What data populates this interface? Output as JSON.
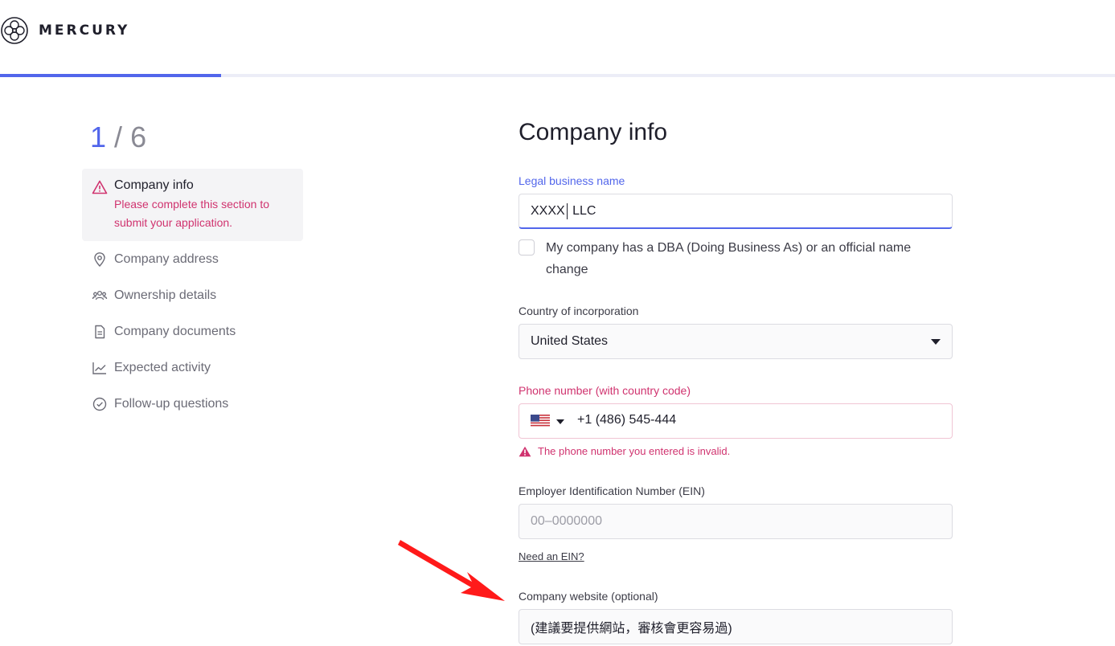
{
  "brand": {
    "name": "MERCURY"
  },
  "progress": {
    "fraction": 0.198
  },
  "steps": {
    "current": "1",
    "separator": "/",
    "total": "6",
    "active": {
      "title": "Company info",
      "message": "Please complete this section to submit your application.",
      "icon": "warning-icon"
    },
    "items": [
      {
        "label": "Company address",
        "icon": "location-pin-icon"
      },
      {
        "label": "Ownership details",
        "icon": "people-icon"
      },
      {
        "label": "Company documents",
        "icon": "document-icon"
      },
      {
        "label": "Expected activity",
        "icon": "line-chart-icon"
      },
      {
        "label": "Follow-up questions",
        "icon": "check-circle-icon"
      }
    ]
  },
  "form": {
    "title": "Company info",
    "legal_name": {
      "label": "Legal business name",
      "value_before_caret": "XXXX",
      "value_after_caret": " LLC"
    },
    "dba": {
      "label": "My company has a DBA (Doing Business As) or an official name change",
      "checked": false
    },
    "country": {
      "label": "Country of incorporation",
      "value": "United States"
    },
    "phone": {
      "label": "Phone number (with country code)",
      "value": "+1 (486) 545-444",
      "country_flag": "us-flag-icon",
      "error": "The phone number you entered is invalid."
    },
    "ein": {
      "label": "Employer Identification Number (EIN)",
      "placeholder": "00–0000000",
      "link": "Need an EIN?"
    },
    "website": {
      "label": "Company website (optional)",
      "value": "(建議要提供網站，審核會更容易過)"
    }
  },
  "colors": {
    "accent": "#5266eb",
    "error": "#d0336f",
    "annotation": "#ff1a1a"
  }
}
